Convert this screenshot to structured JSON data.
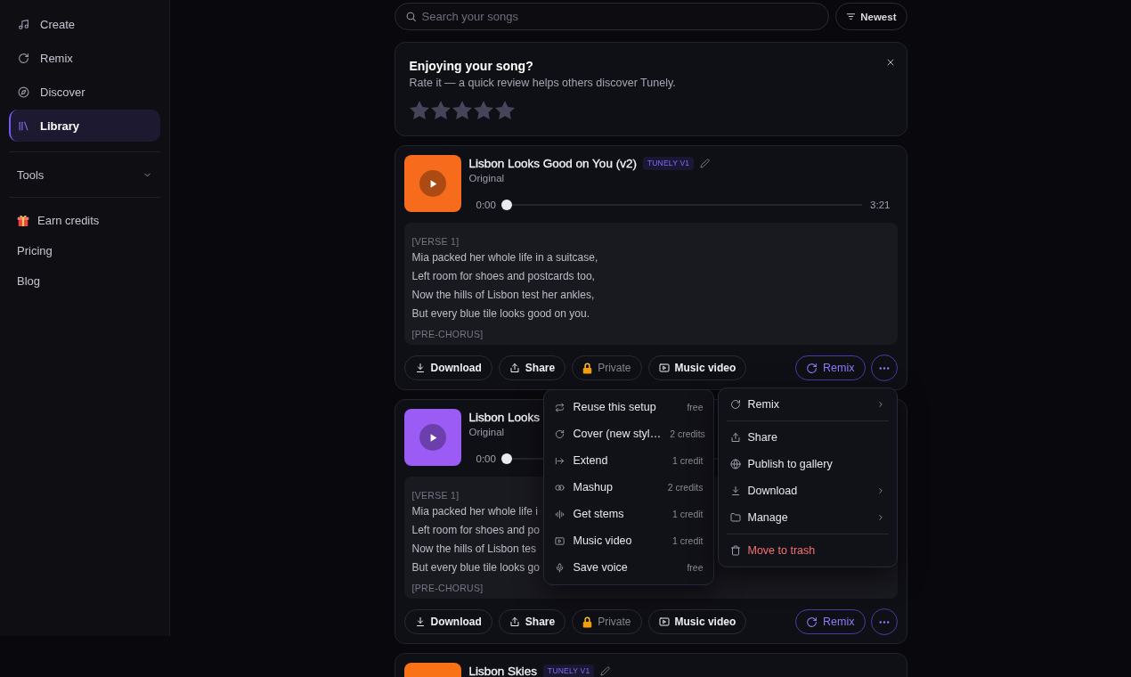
{
  "sidebar": {
    "nav": [
      {
        "label": "Create",
        "selected": false
      },
      {
        "label": "Remix",
        "selected": false
      },
      {
        "label": "Discover",
        "selected": false
      },
      {
        "label": "Library",
        "selected": true
      }
    ],
    "tools": {
      "label": "Tools",
      "expanded": false
    },
    "links": [
      {
        "label": "Earn credits",
        "kind": "reward"
      },
      {
        "label": "Pricing",
        "kind": "plain"
      },
      {
        "label": "Blog",
        "kind": "plain"
      }
    ]
  },
  "search": {
    "placeholder": "Search your songs"
  },
  "sort_button": {
    "label": "Newest"
  },
  "rating": {
    "title": "Enjoying your song?",
    "text": "Rate it — a quick review helps others discover Tunely.",
    "stars": 0
  },
  "songs": [
    {
      "title": "Lisbon Looks Good on You (v2)",
      "badge": "TUNELY V1",
      "subtitle": "Original",
      "color": "#f76b1c",
      "player": {
        "elapsed": "0:00",
        "duration": "3:21",
        "level": 0
      },
      "lyrics": [
        {
          "kind": "section",
          "text": "[VERSE 1]"
        },
        {
          "kind": "line",
          "text": "Mia packed her whole life in a suitcase,"
        },
        {
          "kind": "line",
          "text": "Left room for shoes and postcards too,"
        },
        {
          "kind": "line",
          "text": "Now the hills of Lisbon test her ankles,"
        },
        {
          "kind": "line",
          "text": "But every blue tile looks good on you."
        },
        {
          "kind": "section",
          "text": "[PRE-CHORUS]"
        }
      ],
      "actions": [
        {
          "label": "Download",
          "kind": "plain"
        },
        {
          "label": "Share",
          "kind": "plain"
        },
        {
          "label": "Private",
          "kind": "muted"
        },
        {
          "label": "Music video",
          "kind": "plain"
        },
        {
          "label": "Remix",
          "kind": "accent"
        },
        {
          "kind": "more"
        }
      ]
    },
    {
      "title": "Lisbon Looks",
      "subtitle": "Original",
      "color": "#9b5cf6",
      "player": {
        "elapsed": "0:00",
        "level": 0
      },
      "lyrics": [
        {
          "kind": "section",
          "text": "[VERSE 1]"
        },
        {
          "kind": "line",
          "text": "Mia packed her whole life i"
        },
        {
          "kind": "line",
          "text": "Left room for shoes and po"
        },
        {
          "kind": "line",
          "text": "Now the hills of Lisbon tes"
        },
        {
          "kind": "line",
          "text": "But every blue tile looks go"
        },
        {
          "kind": "section",
          "text": "[PRE-CHORUS]"
        }
      ],
      "actions": [
        {
          "label": "Download",
          "kind": "plain"
        },
        {
          "label": "Share",
          "kind": "plain"
        },
        {
          "label": "Private",
          "kind": "muted"
        },
        {
          "label": "Music video",
          "kind": "plain"
        },
        {
          "label": "Remix",
          "kind": "accent"
        },
        {
          "kind": "more"
        }
      ]
    },
    {
      "title": "Lisbon Skies",
      "badge": "TUNELY V1",
      "color": "#f97316"
    }
  ],
  "remix_submenu": {
    "items": [
      {
        "label": "Reuse this setup",
        "cost": "free"
      },
      {
        "label": "Cover (new styl…",
        "cost": "2 credits"
      },
      {
        "label": "Extend",
        "cost": "1 credit"
      },
      {
        "label": "Mashup",
        "cost": "2 credits"
      },
      {
        "label": "Get stems",
        "cost": "1 credit"
      },
      {
        "label": "Music video",
        "cost": "1 credit"
      },
      {
        "label": "Save voice",
        "cost": "free"
      }
    ]
  },
  "more_menu": {
    "sections": [
      {
        "items": [
          {
            "label": "Remix",
            "kind": "normal",
            "has_submenu": true
          }
        ]
      },
      {
        "items": [
          {
            "label": "Share",
            "kind": "normal",
            "has_submenu": false
          },
          {
            "label": "Publish to gallery",
            "kind": "normal",
            "has_submenu": false
          },
          {
            "label": "Download",
            "kind": "normal",
            "has_submenu": true
          },
          {
            "label": "Manage",
            "kind": "normal",
            "has_submenu": true
          }
        ]
      },
      {
        "items": [
          {
            "label": "Move to trash",
            "kind": "danger",
            "has_submenu": false
          }
        ]
      }
    ]
  }
}
